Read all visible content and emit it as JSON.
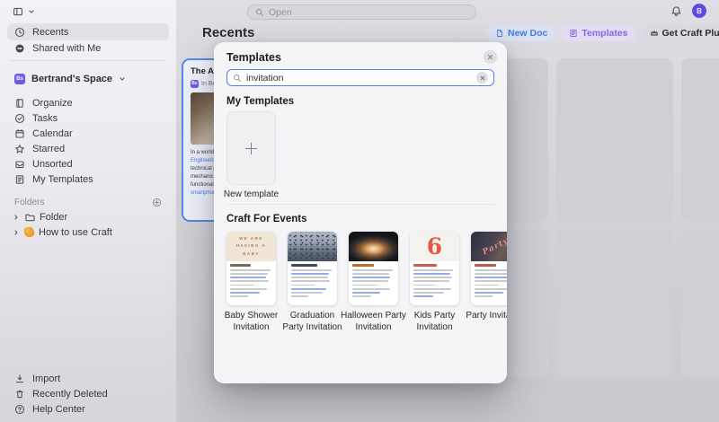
{
  "topbar": {
    "search_placeholder": "Open",
    "avatar_initial": "B"
  },
  "sidebar": {
    "primary": [
      {
        "icon": "clock-icon",
        "label": "Recents",
        "active": true
      },
      {
        "icon": "shared-icon",
        "label": "Shared with Me",
        "active": false
      }
    ],
    "space": {
      "badge": "Bs",
      "label": "Bertrand's Space"
    },
    "space_items": [
      {
        "icon": "book-icon",
        "label": "Organize"
      },
      {
        "icon": "check-circle-icon",
        "label": "Tasks"
      },
      {
        "icon": "calendar-icon",
        "label": "Calendar"
      },
      {
        "icon": "star-icon",
        "label": "Starred"
      },
      {
        "icon": "tray-icon",
        "label": "Unsorted"
      },
      {
        "icon": "template-icon",
        "label": "My Templates"
      }
    ],
    "folders": {
      "header": "Folders",
      "items": [
        {
          "icon": "folder-icon",
          "label": "Folder"
        },
        {
          "icon": "wave-icon",
          "label": "How to use Craft"
        }
      ]
    },
    "footer": [
      {
        "icon": "import-icon",
        "label": "Import"
      },
      {
        "icon": "trash-icon",
        "label": "Recently Deleted"
      },
      {
        "icon": "help-icon",
        "label": "Help Center"
      }
    ]
  },
  "main": {
    "title": "Recents",
    "actions": {
      "new_doc": "New Doc",
      "templates": "Templates",
      "get_craft_plus": "Get Craft Plus"
    },
    "document_card": {
      "title": "The Art of Engineering",
      "space_badge": "Bs",
      "space_label": "In Bertrand's Space",
      "body_lines": [
        "In a world s",
        "Engineering",
        "technical pr",
        "mechanics,",
        "functional v",
        "smartphone"
      ]
    }
  },
  "modal": {
    "title": "Templates",
    "search_value": "invitation",
    "my_templates": {
      "heading": "My Templates",
      "new_label": "New template"
    },
    "events": {
      "heading": "Craft For Events",
      "items": [
        {
          "name": "Baby Shower Invitation",
          "art_text": "WE ARE\nHAVING A\nBABY"
        },
        {
          "name": "Graduation Party Invitation",
          "art_text": ""
        },
        {
          "name": "Halloween Party Invitation",
          "art_text": ""
        },
        {
          "name": "Kids Party Invitation",
          "art_text": "6"
        },
        {
          "name": "Party Invitation",
          "art_text": "Party"
        }
      ]
    }
  },
  "colors": {
    "accent_blue": "#4679E6",
    "accent_purple": "#8766DE",
    "space_badge": "#6E5AE6",
    "focus_ring": "#4E82F2"
  }
}
